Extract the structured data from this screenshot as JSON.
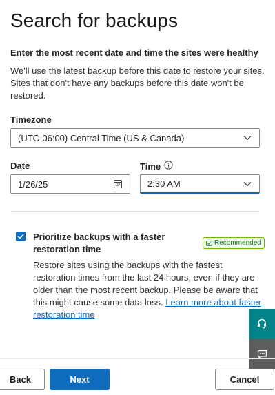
{
  "header": {
    "title": "Search for backups"
  },
  "intro": {
    "subheading": "Enter the most recent date and time the sites were healthy",
    "description": "We'll use the latest backup before this date to restore your sites. Sites that don't have any backups before this date won't be restored."
  },
  "form": {
    "timezone_label": "Timezone",
    "timezone_value": "(UTC-06:00) Central Time (US & Canada)",
    "date_label": "Date",
    "date_value": "1/26/25",
    "time_label": "Time",
    "time_value": "2:30 AM"
  },
  "option": {
    "checked": true,
    "title": "Prioritize backups with a faster restoration time",
    "badge": "Recommended",
    "description": "Restore sites using the backups with the fastest restoration times from the last 24 hours, even if they are older than the most recent backup. Please be aware that this might cause some data loss.",
    "link_text": "Learn more about faster restoration time"
  },
  "footer": {
    "back_label": "Back",
    "next_label": "Next",
    "cancel_label": "Cancel"
  },
  "colors": {
    "accent": "#0f6cbd",
    "help_button": "#038387",
    "feedback_button": "#605e5c",
    "badge_green": "#107c10"
  },
  "icons": [
    "info-icon",
    "calendar-icon",
    "chevron-down-icon",
    "checkmark-icon",
    "headset-icon",
    "feedback-icon"
  ]
}
